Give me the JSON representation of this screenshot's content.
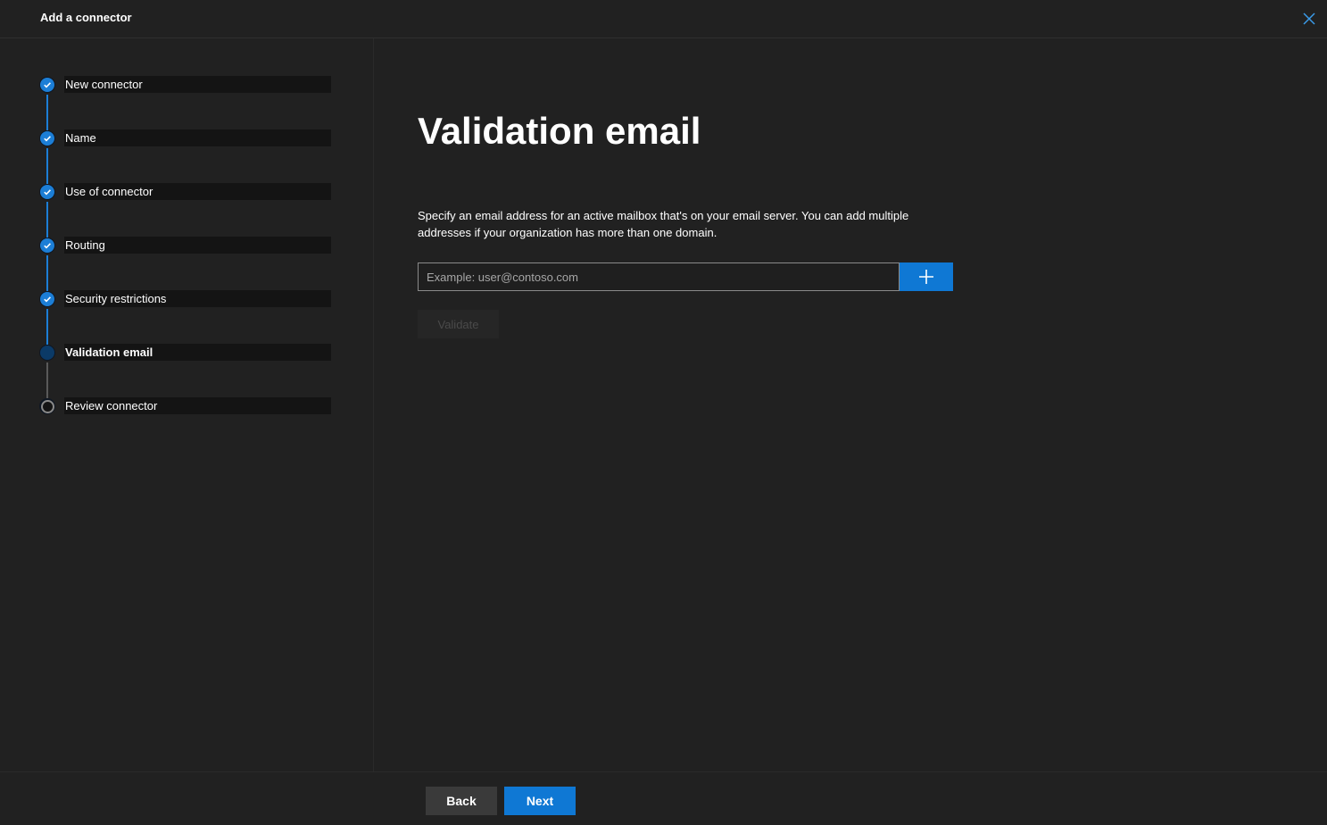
{
  "header": {
    "title": "Add a connector",
    "close_icon": "close-icon"
  },
  "steps": [
    {
      "label": "New connector",
      "status": "complete"
    },
    {
      "label": "Name",
      "status": "complete"
    },
    {
      "label": "Use of connector",
      "status": "complete"
    },
    {
      "label": "Routing",
      "status": "complete"
    },
    {
      "label": "Security restrictions",
      "status": "complete"
    },
    {
      "label": "Validation email",
      "status": "current"
    },
    {
      "label": "Review connector",
      "status": "pending"
    }
  ],
  "main": {
    "title": "Validation email",
    "description": "Specify an email address for an active mailbox that's on your email server. You can add multiple addresses if your organization has more than one domain.",
    "email_input": {
      "value": "",
      "placeholder": "Example: user@contoso.com"
    },
    "add_icon": "plus-icon",
    "validate_label": "Validate"
  },
  "footer": {
    "back_label": "Back",
    "next_label": "Next"
  },
  "colors": {
    "background": "#212121",
    "accent": "#0f78d4",
    "step_complete": "#1c7ed6",
    "step_current": "#0b3a67",
    "step_pending_line": "#5a5a5a"
  }
}
